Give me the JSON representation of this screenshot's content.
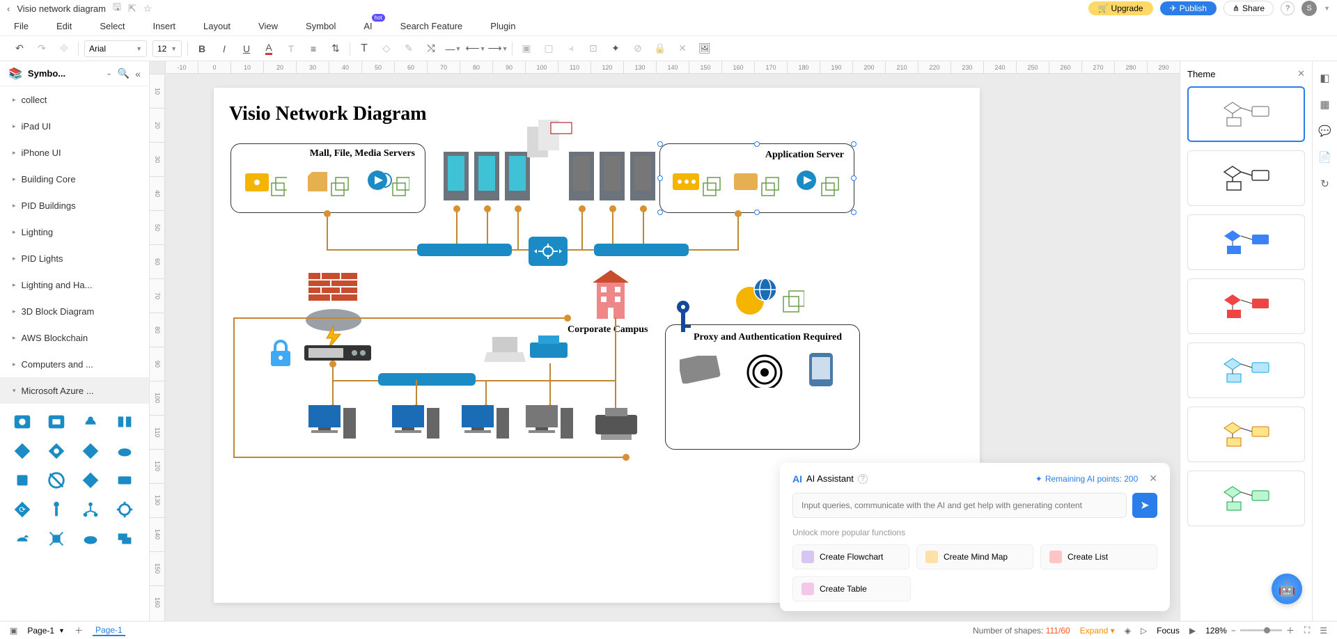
{
  "titlebar": {
    "doc_title": "Visio network diagram",
    "upgrade": "Upgrade",
    "publish": "Publish",
    "share": "Share",
    "avatar_initial": "S"
  },
  "menu": {
    "items": [
      "File",
      "Edit",
      "Select",
      "Insert",
      "Layout",
      "View",
      "Symbol",
      "AI",
      "Search Feature",
      "Plugin"
    ],
    "hot_badge": "hot"
  },
  "toolbar": {
    "font": "Arial",
    "size": "12"
  },
  "sidebar": {
    "title": "Symbo...",
    "categories": [
      "collect",
      "iPad UI",
      "iPhone UI",
      "Building Core",
      "PID Buildings",
      "Lighting",
      "PID Lights",
      "Lighting and Ha...",
      "3D Block Diagram",
      "AWS Blockchain",
      "Computers and ...",
      "Microsoft Azure ..."
    ]
  },
  "ruler_h": [
    "-10",
    "0",
    "10",
    "20",
    "30",
    "40",
    "50",
    "60",
    "70",
    "80",
    "90",
    "100",
    "110",
    "120",
    "130",
    "140",
    "150",
    "160",
    "170",
    "180",
    "190",
    "200",
    "210",
    "220",
    "230",
    "240",
    "250",
    "260",
    "270",
    "280",
    "290"
  ],
  "ruler_v": [
    "10",
    "20",
    "30",
    "40",
    "50",
    "60",
    "70",
    "80",
    "90",
    "100",
    "110",
    "120",
    "130",
    "140",
    "150",
    "160"
  ],
  "diagram": {
    "title": "Visio Network Diagram",
    "box_mall": "Mall, File, Media Servers",
    "box_app": "Application Server",
    "corp_campus": "Corporate Campus",
    "proxy_auth": "Proxy and Authentication Required"
  },
  "theme": {
    "title": "Theme"
  },
  "ai": {
    "title": "AI Assistant",
    "points_label": "Remaining AI points: 200",
    "placeholder": "Input queries, communicate with the AI and get help with generating content",
    "unlock": "Unlock more popular functions",
    "actions": [
      "Create Flowchart",
      "Create Mind Map",
      "Create List",
      "Create Table"
    ]
  },
  "status": {
    "page_sel": "Page-1",
    "page_tab": "Page-1",
    "shapes_label": "Number of shapes:",
    "shapes_count": "111/60",
    "expand": "Expand",
    "focus": "Focus",
    "zoom": "128%"
  }
}
